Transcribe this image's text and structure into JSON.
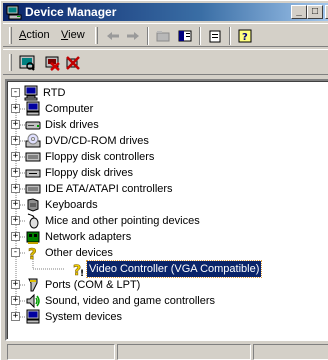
{
  "window": {
    "title": "Device Manager",
    "controls": {
      "minimize": "_",
      "maximize": "□",
      "close": "X"
    }
  },
  "menubar": {
    "items": [
      {
        "label": "Action",
        "accel": "A",
        "rest": "ction"
      },
      {
        "label": "View",
        "accel": "V",
        "rest": "iew"
      }
    ],
    "toolbar_icons": [
      "back-arrow-icon",
      "forward-arrow-icon",
      "up-folder-icon",
      "show-hide-tree-icon",
      "properties-icon",
      "help-icon"
    ]
  },
  "toolbar2": {
    "icons": [
      "scan-hardware-icon",
      "disable-device-icon",
      "uninstall-device-icon"
    ]
  },
  "tree": {
    "root": "RTD",
    "items": [
      {
        "label": "Computer",
        "icon": "computer-icon",
        "expander": "+"
      },
      {
        "label": "Disk drives",
        "icon": "disk-drive-icon",
        "expander": "+"
      },
      {
        "label": "DVD/CD-ROM drives",
        "icon": "cdrom-icon",
        "expander": "+"
      },
      {
        "label": "Floppy disk controllers",
        "icon": "controller-icon",
        "expander": "+"
      },
      {
        "label": "Floppy disk drives",
        "icon": "floppy-drive-icon",
        "expander": "+"
      },
      {
        "label": "IDE ATA/ATAPI controllers",
        "icon": "ide-controller-icon",
        "expander": "+"
      },
      {
        "label": "Keyboards",
        "icon": "keyboard-icon",
        "expander": "+"
      },
      {
        "label": "Mice and other pointing devices",
        "icon": "mouse-icon",
        "expander": "+"
      },
      {
        "label": "Network adapters",
        "icon": "network-adapter-icon",
        "expander": "+"
      },
      {
        "label": "Other devices",
        "icon": "unknown-device-icon",
        "expander": "-"
      },
      {
        "label": "Video Controller (VGA Compatible)",
        "icon": "warning-device-icon",
        "child": true,
        "selected": true
      },
      {
        "label": "Ports (COM & LPT)",
        "icon": "port-icon",
        "expander": "+"
      },
      {
        "label": "Sound, video and game controllers",
        "icon": "sound-icon",
        "expander": "+"
      },
      {
        "label": "System devices",
        "icon": "system-device-icon",
        "expander": "+"
      }
    ]
  },
  "colors": {
    "titlebar_start": "#0a246a",
    "titlebar_end": "#a6caf0",
    "selection": "#0a246a",
    "face": "#d4d0c8"
  }
}
